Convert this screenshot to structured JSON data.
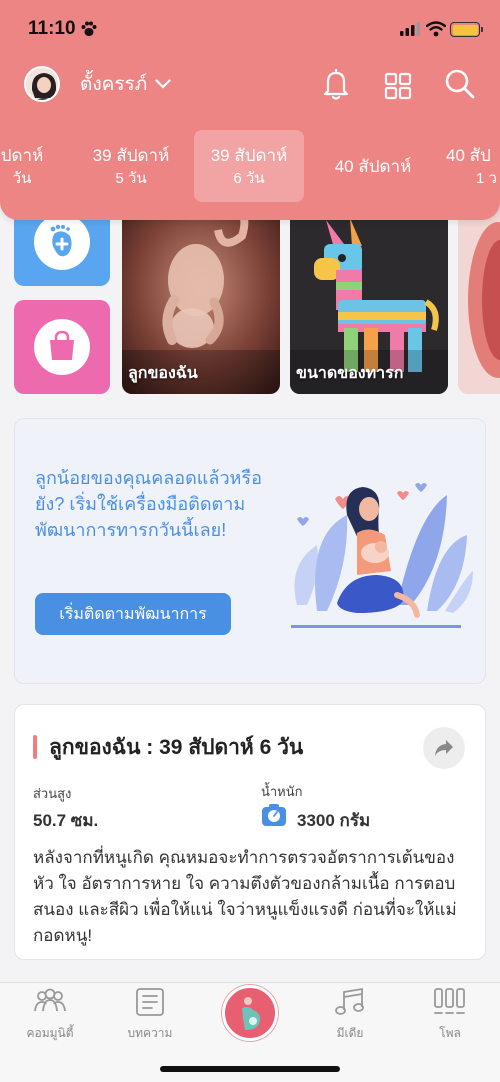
{
  "status": {
    "time": "11:10"
  },
  "profile": {
    "name": "ตั้งครรภ์"
  },
  "weeks": [
    {
      "label": "ปดาห์",
      "sub": "วัน"
    },
    {
      "label": "39 สัปดาห์",
      "sub": "5 วัน"
    },
    {
      "label": "39 สัปดาห์",
      "sub": "6 วัน"
    },
    {
      "label": "40 สัปดาห์",
      "sub": ""
    },
    {
      "label": "40 สัป",
      "sub": "1 ว"
    }
  ],
  "cards": {
    "my_baby": "ลูกของฉัน",
    "baby_size": "ขนาดของทารก"
  },
  "promo": {
    "text": "ลูกน้อยของคุณคลอดแล้วหรือยัง? เริ่มใช้เครื่องมือติดตามพัฒนาการทารกวันนี้เลย!",
    "button": "เริ่มติดตามพัฒนาการ"
  },
  "info": {
    "title": "ลูกของฉัน : 39 สัปดาห์ 6  วัน",
    "height_label": "ส่วนสูง",
    "height_value": "50.7 ซม.",
    "weight_label": "น้ำหนัก",
    "weight_value": "3300 กรัม",
    "body": "หลังจากที่หนูเกิด คุณหมอจะทำการตรวจอัตราการเต้นของหัว ใจ อัตราการหาย ใจ ความตึงตัวของกล้ามเนื้อ การตอบสนอง และสีผิว เพื่อให้แน่ ใจว่าหนูแข็งแรงดี ก่อนที่จะให้แม่กอดหนู!"
  },
  "nav": {
    "community": "คอมมูนิตี้",
    "articles": "บทความ",
    "media": "มีเดีย",
    "poll": "โพล"
  },
  "colors": {
    "header": "#ee8585",
    "accent_blue": "#4a90e2",
    "tile_blue": "#5aa5f0",
    "tile_pink": "#ee6aae"
  }
}
